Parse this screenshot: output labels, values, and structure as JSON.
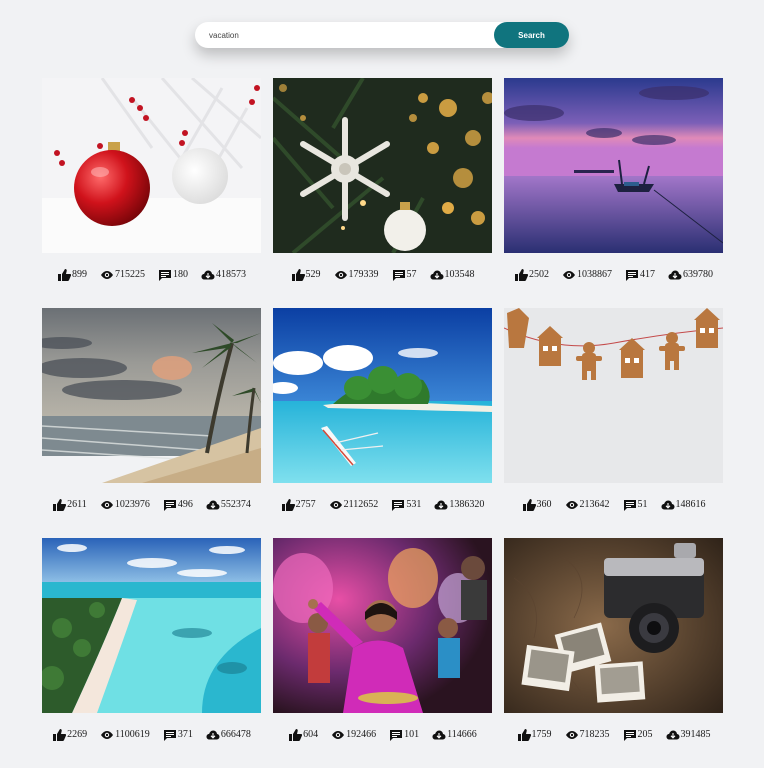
{
  "search": {
    "value": "vacation",
    "button_label": "Search"
  },
  "images": [
    {
      "subject": "red-christmas-ornament",
      "likes": "899",
      "views": "715225",
      "comments": "180",
      "downloads": "418573"
    },
    {
      "subject": "snowflake-ornament-tree",
      "likes": "529",
      "views": "179339",
      "comments": "57",
      "downloads": "103548"
    },
    {
      "subject": "sunset-lake-boat",
      "likes": "2502",
      "views": "1038867",
      "comments": "417",
      "downloads": "639780"
    },
    {
      "subject": "stormy-beach-palms",
      "likes": "2611",
      "views": "1023976",
      "comments": "496",
      "downloads": "552374"
    },
    {
      "subject": "tropical-island-boat",
      "likes": "2757",
      "views": "2112652",
      "comments": "531",
      "downloads": "1386320"
    },
    {
      "subject": "gingerbread-garland",
      "likes": "360",
      "views": "213642",
      "comments": "51",
      "downloads": "148616"
    },
    {
      "subject": "aerial-tropical-beach",
      "likes": "2269",
      "views": "1100619",
      "comments": "371",
      "downloads": "666478"
    },
    {
      "subject": "holi-festival-woman",
      "likes": "604",
      "views": "192466",
      "comments": "101",
      "downloads": "114666"
    },
    {
      "subject": "vintage-camera-photos",
      "likes": "1759",
      "views": "718235",
      "comments": "205",
      "downloads": "391485"
    }
  ],
  "icons": {
    "likes": "thumbs-up-icon",
    "views": "eye-icon",
    "comments": "comment-icon",
    "downloads": "cloud-download-icon"
  },
  "colors": {
    "accent": "#10747e",
    "background": "#f1f2f4"
  }
}
